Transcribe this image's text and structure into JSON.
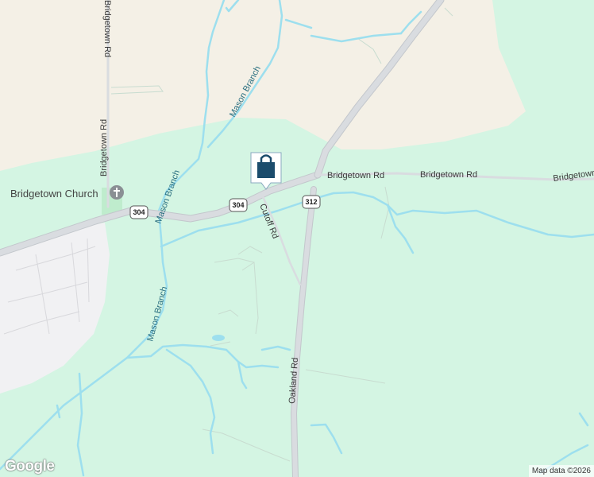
{
  "labels": {
    "bridgetown_rd_vertical_top": "Bridgetown Rd",
    "bridgetown_rd_vertical_mid": "Bridgetown Rd",
    "bridgetown_rd_east_1": "Bridgetown Rd",
    "bridgetown_rd_east_2": "Bridgetown Rd",
    "bridgetown_rd_east_3": "Bridgetown Rd",
    "bridgetown_church": "Bridgetown Church",
    "mason_branch_1": "Mason Branch",
    "mason_branch_2": "Mason Branch",
    "mason_branch_3": "Mason Branch",
    "cutoff_rd": "Cutoff Rd",
    "oakland_rd": "Oakland Rd"
  },
  "shields": {
    "route_304": "304",
    "route_312": "312"
  },
  "marker": {
    "icon": "shopping-bag-icon"
  },
  "poi_icon": "church-cross-icon",
  "logo": "Google",
  "attribution": "Map data ©2026",
  "colors": {
    "forest": "#d4f5e3",
    "farmland": "#f4f0e6",
    "urban": "#f1f1f3",
    "water": "#9ddfee",
    "road": "#d5d8dc",
    "road_edge": "#c3c7cc",
    "marker": "#1b4c6c"
  }
}
